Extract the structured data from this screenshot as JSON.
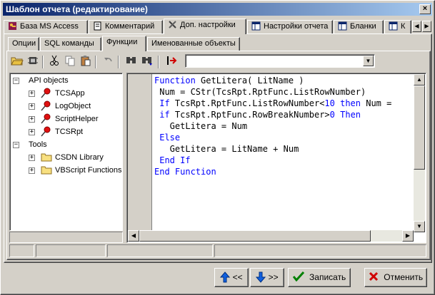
{
  "window": {
    "title": "Шаблон отчета (редактирование)",
    "close_glyph": "×"
  },
  "main_tabs": [
    {
      "label": "База MS Access",
      "icon": "key-icon"
    },
    {
      "label": "Комментарий",
      "icon": "document-icon"
    },
    {
      "label": "Доп. настройки",
      "icon": "tools-icon",
      "active": true
    },
    {
      "label": "Настройки отчета",
      "icon": "table-icon"
    },
    {
      "label": "Бланки",
      "icon": "table-icon"
    },
    {
      "label": "К",
      "icon": "table-icon"
    }
  ],
  "sub_tabs": [
    {
      "label": "Опции"
    },
    {
      "label": "SQL команды"
    },
    {
      "label": "Функции",
      "active": true
    },
    {
      "label": "Именованные объекты"
    }
  ],
  "toolbar": {
    "icons": [
      "open-folder-icon",
      "compile-icon",
      "cut-icon",
      "copy-icon",
      "paste-icon",
      "undo-icon",
      "find-icon",
      "find-next-icon",
      "run-icon"
    ],
    "combo_value": ""
  },
  "tree": {
    "groups": [
      {
        "label": "API objects",
        "expanded": true,
        "children": [
          {
            "label": "TCSApp",
            "icon": "red-pin-icon"
          },
          {
            "label": "LogObject",
            "icon": "red-pin-icon"
          },
          {
            "label": "ScriptHelper",
            "icon": "red-pin-icon"
          },
          {
            "label": "TCSRpt",
            "icon": "red-pin-icon"
          }
        ]
      },
      {
        "label": "Tools",
        "expanded": true,
        "children": [
          {
            "label": "CSDN Library",
            "icon": "folder-icon"
          },
          {
            "label": "VBScript Functions",
            "icon": "folder-icon"
          }
        ]
      }
    ]
  },
  "code": {
    "lines": [
      [
        {
          "t": "Function ",
          "k": true
        },
        {
          "t": "GetLitera",
          "k": false
        },
        {
          "t": "( LitName )",
          "k": false
        }
      ],
      [
        {
          "t": " Num = CStr(TcsRpt.RptFunc.ListRowNumber)",
          "k": false
        }
      ],
      [
        {
          "t": " If ",
          "k": true
        },
        {
          "t": "TcsRpt.RptFunc.ListRowNumber<",
          "k": false
        },
        {
          "t": "10",
          "k": true
        },
        {
          "t": " then ",
          "k": true
        },
        {
          "t": "Num = ",
          "k": false
        }
      ],
      [
        {
          "t": " if ",
          "k": true
        },
        {
          "t": "TcsRpt.RptFunc.RowBreakNumber>",
          "k": false
        },
        {
          "t": "0",
          "k": true
        },
        {
          "t": " Then",
          "k": true
        }
      ],
      [
        {
          "t": "   GetLitera = Num",
          "k": false
        }
      ],
      [
        {
          "t": " Else",
          "k": true
        }
      ],
      [
        {
          "t": "   GetLitera = LitName + Num",
          "k": false
        }
      ],
      [
        {
          "t": " End If",
          "k": true
        }
      ],
      [
        {
          "t": "End Function",
          "k": true
        }
      ]
    ]
  },
  "buttons": {
    "prev_label": "<<",
    "next_label": ">>",
    "save_label": "Записать",
    "cancel_label": "Отменить"
  },
  "colors": {
    "keyword": "#0000ff",
    "title_gradient_start": "#0a246a",
    "title_gradient_end": "#a6caf0"
  }
}
